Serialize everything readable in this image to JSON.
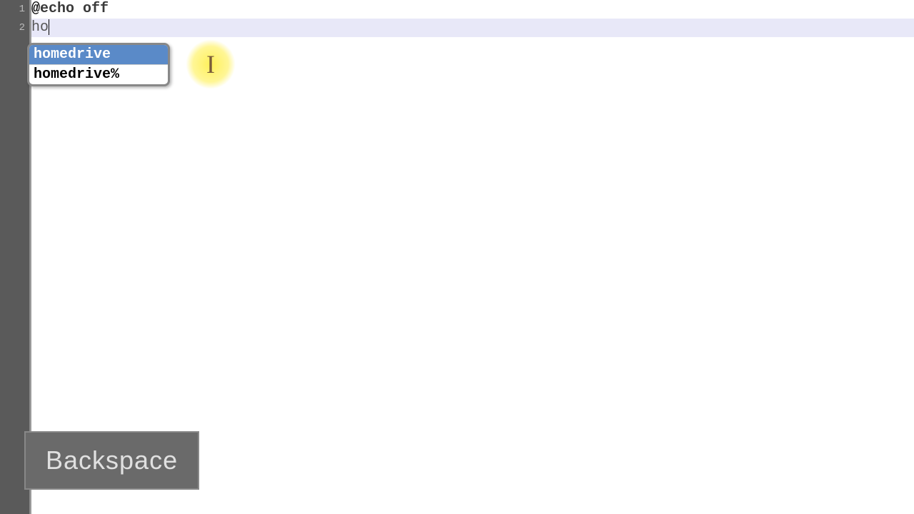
{
  "editor": {
    "lines": {
      "1": {
        "number": "1",
        "at": "@",
        "cmd": "echo",
        "arg": "off"
      },
      "2": {
        "number": "2",
        "typed": "ho"
      }
    }
  },
  "autocomplete": {
    "items": [
      "homedrive",
      "homedrive%"
    ],
    "selected_index": 0
  },
  "highlight": {
    "cursor_glyph": "I"
  },
  "key_indicator": {
    "label": "Backspace"
  }
}
